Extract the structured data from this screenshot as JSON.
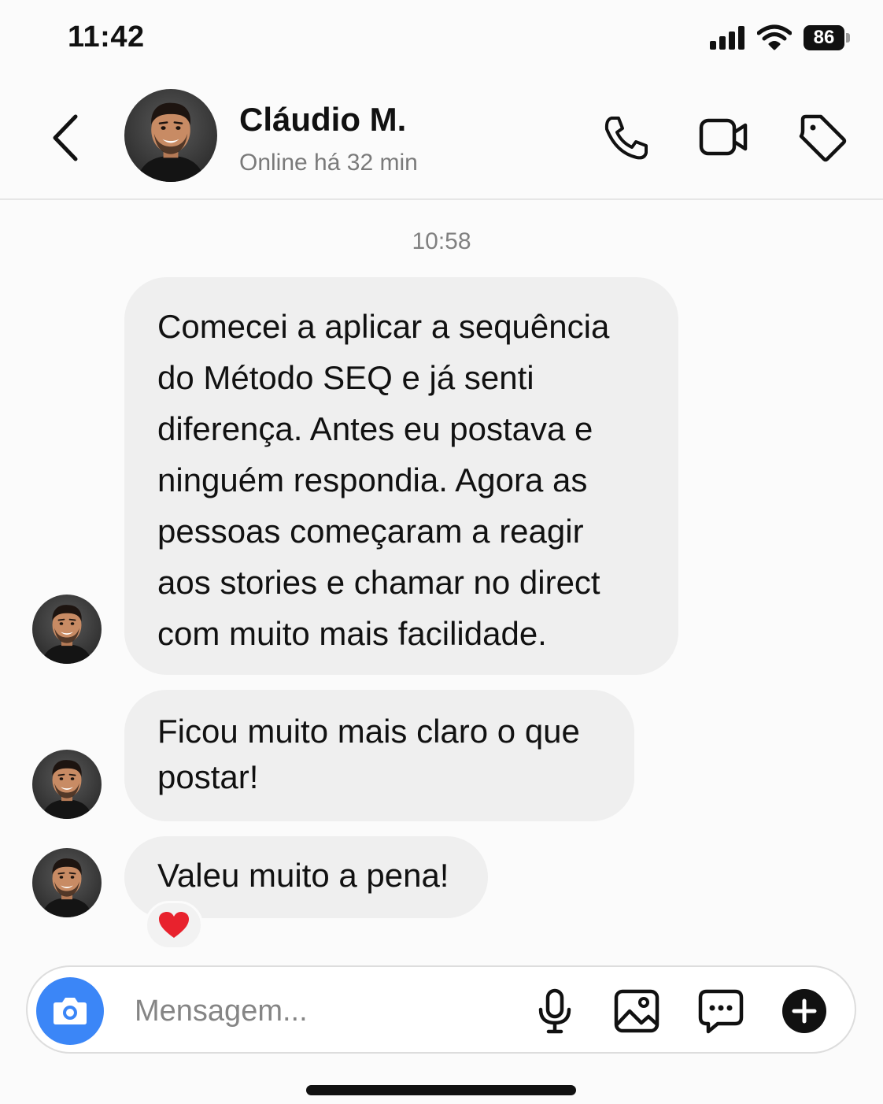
{
  "status_bar": {
    "time": "11:42",
    "battery": "86",
    "icons": [
      "signal-icon",
      "wifi-icon",
      "battery-icon"
    ]
  },
  "header": {
    "contact_name": "Cláudio M.",
    "contact_status": "Online há 32 min",
    "icons": [
      "back-chevron-icon",
      "phone-icon",
      "video-camera-icon",
      "tag-icon"
    ]
  },
  "conversation": {
    "timestamp": "10:58",
    "messages": [
      {
        "text": "Comecei a aplicar a sequência do Método SEQ e já senti diferença. Antes eu postava e ninguém respondia. Agora as pessoas começaram a reagir aos stories e chamar no direct com muito mais facilidade."
      },
      {
        "text": "Ficou muito mais claro o que postar!"
      },
      {
        "text": "Valeu muito a pena!",
        "reaction": "❤️"
      }
    ]
  },
  "composer": {
    "placeholder": "Mensagem...",
    "icons": [
      "camera-icon",
      "microphone-icon",
      "gallery-icon",
      "sticker-chat-icon",
      "plus-icon"
    ],
    "camera_color": "#3b86f7"
  },
  "colors": {
    "bubble": "#efefef",
    "reaction_heart": "#e8222d",
    "accent": "#3b86f7"
  }
}
